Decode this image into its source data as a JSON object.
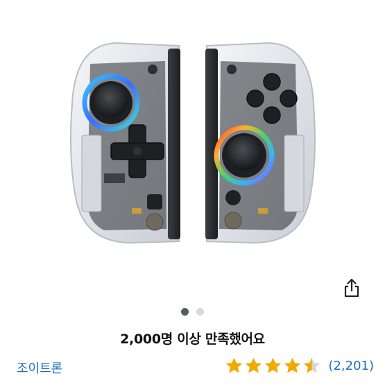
{
  "gallery": {
    "image_alt": "",
    "dot_count": 2,
    "active_index": 0
  },
  "summary": {
    "satisfaction_text": "2,000명 이상 만족했어요"
  },
  "product": {
    "brand": "조이트론",
    "rating": 4.5,
    "review_count": "(2,201)"
  },
  "colors": {
    "link": "#1f6fbf",
    "star": "#f2a900",
    "star_empty": "#d6d6d6",
    "dot_active": "#555b60",
    "dot_inactive": "#d9d9d9"
  },
  "icons": {
    "share": "share-icon",
    "star": "star-icon"
  }
}
